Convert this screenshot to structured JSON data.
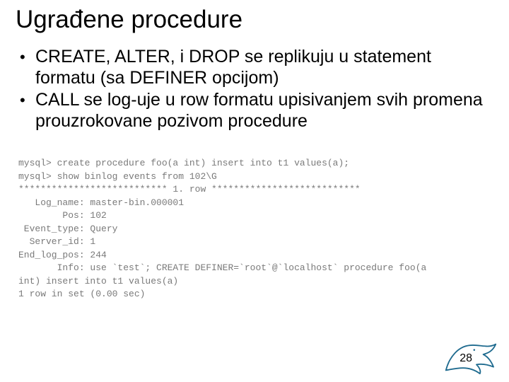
{
  "title": "Ugrađene procedure",
  "bullets": [
    "CREATE, ALTER, i DROP se replikuju u statement formatu (sa DEFINER opcijom)",
    " CALL se log-uje u row formatu upisivanjem svih promena prouzrokovane pozivom procedure"
  ],
  "code_lines": [
    "mysql> create procedure foo(a int) insert into t1 values(a);",
    "mysql> show binlog events from 102\\G",
    "*************************** 1. row ***************************",
    "   Log_name: master-bin.000001",
    "        Pos: 102",
    " Event_type: Query",
    "  Server_id: 1",
    "End_log_pos: 244",
    "       Info: use `test`; CREATE DEFINER=`root`@`localhost` procedure foo(a",
    "int) insert into t1 values(a)",
    "1 row in set (0.00 sec)"
  ],
  "page_number": "28"
}
